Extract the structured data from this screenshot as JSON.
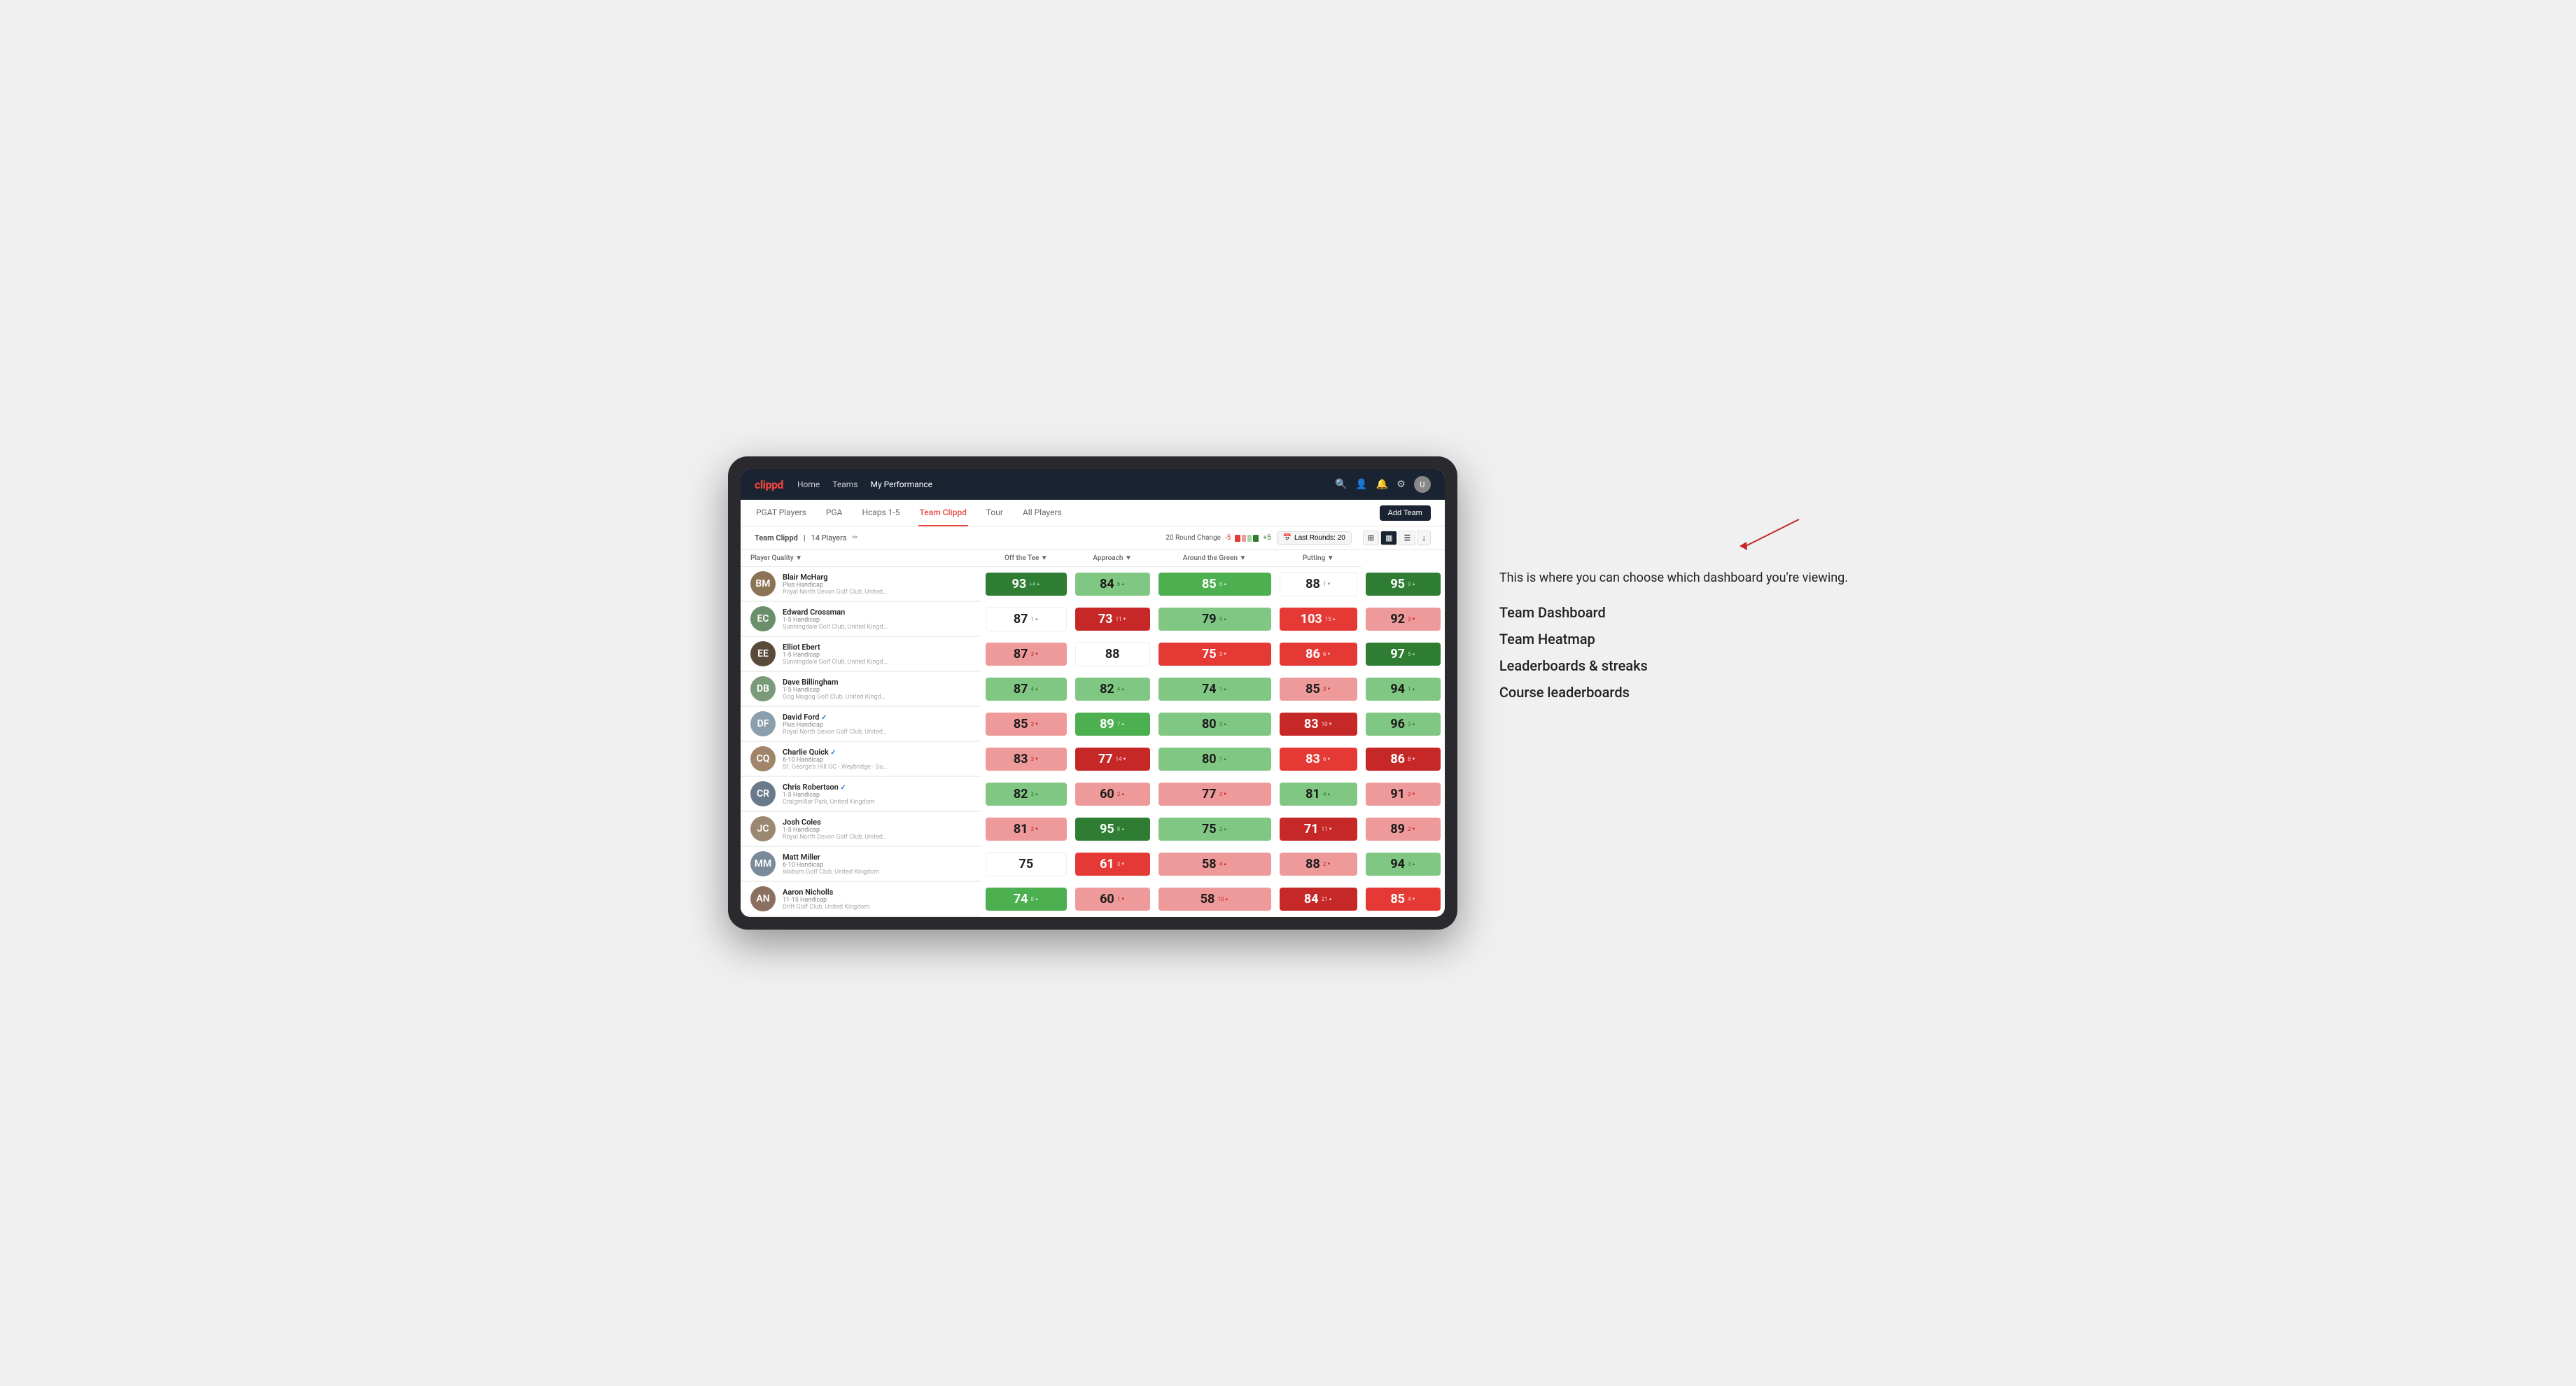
{
  "annotation": {
    "intro": "This is where you can choose which dashboard you're viewing.",
    "items": [
      "Team Dashboard",
      "Team Heatmap",
      "Leaderboards & streaks",
      "Course leaderboards"
    ]
  },
  "nav": {
    "logo": "clippd",
    "links": [
      {
        "label": "Home",
        "active": false
      },
      {
        "label": "Teams",
        "active": false
      },
      {
        "label": "My Performance",
        "active": true
      }
    ],
    "icons": [
      "search",
      "person",
      "bell",
      "settings",
      "avatar"
    ]
  },
  "sub_nav": {
    "links": [
      {
        "label": "PGAT Players",
        "active": false
      },
      {
        "label": "PGA",
        "active": false
      },
      {
        "label": "Hcaps 1-5",
        "active": false
      },
      {
        "label": "Team Clippd",
        "active": true
      },
      {
        "label": "Tour",
        "active": false
      },
      {
        "label": "All Players",
        "active": false
      }
    ],
    "add_team_label": "Add Team"
  },
  "team_header": {
    "name": "Team Clippd",
    "count": "14 Players",
    "round_change_label": "20 Round Change",
    "minus_label": "-5",
    "plus_label": "+5",
    "last_rounds_label": "Last Rounds: 20",
    "views": [
      "grid",
      "heatmap",
      "list",
      "export"
    ]
  },
  "table": {
    "columns": [
      {
        "label": "Player Quality ▼",
        "key": "quality"
      },
      {
        "label": "Off the Tee ▼",
        "key": "off_tee"
      },
      {
        "label": "Approach ▼",
        "key": "approach"
      },
      {
        "label": "Around the Green ▼",
        "key": "around_green"
      },
      {
        "label": "Putting ▼",
        "key": "putting"
      }
    ],
    "rows": [
      {
        "name": "Blair McHarg",
        "handicap": "Plus Handicap",
        "club": "Royal North Devon Golf Club, United Kingdom",
        "avatar_color": "#8b7355",
        "initials": "BM",
        "quality": {
          "value": 93,
          "change": "+4",
          "dir": "up",
          "bg": "bg-green-strong"
        },
        "off_tee": {
          "value": 84,
          "change": "6",
          "dir": "up",
          "bg": "bg-green-light"
        },
        "approach": {
          "value": 85,
          "change": "8",
          "dir": "up",
          "bg": "bg-green-medium"
        },
        "around_green": {
          "value": 88,
          "change": "1",
          "dir": "down",
          "bg": "bg-white"
        },
        "putting": {
          "value": 95,
          "change": "9",
          "dir": "up",
          "bg": "bg-green-strong"
        }
      },
      {
        "name": "Edward Crossman",
        "handicap": "1-5 Handicap",
        "club": "Sunningdale Golf Club, United Kingdom",
        "avatar_color": "#6b8e6b",
        "initials": "EC",
        "quality": {
          "value": 87,
          "change": "1",
          "dir": "up",
          "bg": "bg-white"
        },
        "off_tee": {
          "value": 73,
          "change": "11",
          "dir": "down",
          "bg": "bg-red-strong"
        },
        "approach": {
          "value": 79,
          "change": "9",
          "dir": "up",
          "bg": "bg-green-light"
        },
        "around_green": {
          "value": 103,
          "change": "15",
          "dir": "up",
          "bg": "bg-red-medium"
        },
        "putting": {
          "value": 92,
          "change": "3",
          "dir": "down",
          "bg": "bg-red-light"
        }
      },
      {
        "name": "Elliot Ebert",
        "handicap": "1-5 Handicap",
        "club": "Sunningdale Golf Club, United Kingdom",
        "avatar_color": "#5a4a3a",
        "initials": "EE",
        "quality": {
          "value": 87,
          "change": "3",
          "dir": "down",
          "bg": "bg-red-light"
        },
        "off_tee": {
          "value": 88,
          "change": "",
          "dir": "",
          "bg": "bg-white"
        },
        "approach": {
          "value": 75,
          "change": "3",
          "dir": "down",
          "bg": "bg-red-medium"
        },
        "around_green": {
          "value": 86,
          "change": "6",
          "dir": "down",
          "bg": "bg-red-medium"
        },
        "putting": {
          "value": 97,
          "change": "5",
          "dir": "up",
          "bg": "bg-green-strong"
        }
      },
      {
        "name": "Dave Billingham",
        "handicap": "1-5 Handicap",
        "club": "Gog Magog Golf Club, United Kingdom",
        "avatar_color": "#7a9a7a",
        "initials": "DB",
        "quality": {
          "value": 87,
          "change": "4",
          "dir": "up",
          "bg": "bg-green-light"
        },
        "off_tee": {
          "value": 82,
          "change": "4",
          "dir": "up",
          "bg": "bg-green-light"
        },
        "approach": {
          "value": 74,
          "change": "1",
          "dir": "up",
          "bg": "bg-green-light"
        },
        "around_green": {
          "value": 85,
          "change": "3",
          "dir": "down",
          "bg": "bg-red-light"
        },
        "putting": {
          "value": 94,
          "change": "1",
          "dir": "up",
          "bg": "bg-green-light"
        }
      },
      {
        "name": "David Ford",
        "handicap": "Plus Handicap",
        "club": "Royal North Devon Golf Club, United Kingdom",
        "avatar_color": "#8b9eab",
        "initials": "DF",
        "verified": true,
        "quality": {
          "value": 85,
          "change": "3",
          "dir": "down",
          "bg": "bg-red-light"
        },
        "off_tee": {
          "value": 89,
          "change": "7",
          "dir": "up",
          "bg": "bg-green-medium"
        },
        "approach": {
          "value": 80,
          "change": "3",
          "dir": "up",
          "bg": "bg-green-light"
        },
        "around_green": {
          "value": 83,
          "change": "10",
          "dir": "down",
          "bg": "bg-red-strong"
        },
        "putting": {
          "value": 96,
          "change": "3",
          "dir": "up",
          "bg": "bg-green-light"
        }
      },
      {
        "name": "Charlie Quick",
        "handicap": "6-10 Handicap",
        "club": "St. George's Hill GC - Weybridge - Surrey, Uni...",
        "avatar_color": "#a0856b",
        "initials": "CQ",
        "verified": true,
        "quality": {
          "value": 83,
          "change": "3",
          "dir": "down",
          "bg": "bg-red-light"
        },
        "off_tee": {
          "value": 77,
          "change": "14",
          "dir": "down",
          "bg": "bg-red-strong"
        },
        "approach": {
          "value": 80,
          "change": "1",
          "dir": "up",
          "bg": "bg-green-light"
        },
        "around_green": {
          "value": 83,
          "change": "6",
          "dir": "down",
          "bg": "bg-red-medium"
        },
        "putting": {
          "value": 86,
          "change": "8",
          "dir": "down",
          "bg": "bg-red-strong"
        }
      },
      {
        "name": "Chris Robertson",
        "handicap": "1-5 Handicap",
        "club": "Craigmillar Park, United Kingdom",
        "avatar_color": "#6b7a8b",
        "initials": "CR",
        "verified": true,
        "quality": {
          "value": 82,
          "change": "3",
          "dir": "up",
          "bg": "bg-green-light"
        },
        "off_tee": {
          "value": 60,
          "change": "2",
          "dir": "up",
          "bg": "bg-red-light"
        },
        "approach": {
          "value": 77,
          "change": "3",
          "dir": "down",
          "bg": "bg-red-light"
        },
        "around_green": {
          "value": 81,
          "change": "4",
          "dir": "up",
          "bg": "bg-green-light"
        },
        "putting": {
          "value": 91,
          "change": "3",
          "dir": "down",
          "bg": "bg-red-light"
        }
      },
      {
        "name": "Josh Coles",
        "handicap": "1-5 Handicap",
        "club": "Royal North Devon Golf Club, United Kingdom",
        "avatar_color": "#9b8870",
        "initials": "JC",
        "quality": {
          "value": 81,
          "change": "3",
          "dir": "down",
          "bg": "bg-red-light"
        },
        "off_tee": {
          "value": 95,
          "change": "8",
          "dir": "up",
          "bg": "bg-green-strong"
        },
        "approach": {
          "value": 75,
          "change": "2",
          "dir": "up",
          "bg": "bg-green-light"
        },
        "around_green": {
          "value": 71,
          "change": "11",
          "dir": "down",
          "bg": "bg-red-strong"
        },
        "putting": {
          "value": 89,
          "change": "2",
          "dir": "down",
          "bg": "bg-red-light"
        }
      },
      {
        "name": "Matt Miller",
        "handicap": "6-10 Handicap",
        "club": "Woburn Golf Club, United Kingdom",
        "avatar_color": "#7a8a9a",
        "initials": "MM",
        "quality": {
          "value": 75,
          "change": "",
          "dir": "",
          "bg": "bg-white"
        },
        "off_tee": {
          "value": 61,
          "change": "3",
          "dir": "down",
          "bg": "bg-red-medium"
        },
        "approach": {
          "value": 58,
          "change": "4",
          "dir": "up",
          "bg": "bg-red-light"
        },
        "around_green": {
          "value": 88,
          "change": "2",
          "dir": "down",
          "bg": "bg-red-light"
        },
        "putting": {
          "value": 94,
          "change": "3",
          "dir": "up",
          "bg": "bg-green-light"
        }
      },
      {
        "name": "Aaron Nicholls",
        "handicap": "11-15 Handicap",
        "club": "Drift Golf Club, United Kingdom",
        "avatar_color": "#8a7060",
        "initials": "AN",
        "quality": {
          "value": 74,
          "change": "8",
          "dir": "up",
          "bg": "bg-green-medium"
        },
        "off_tee": {
          "value": 60,
          "change": "1",
          "dir": "down",
          "bg": "bg-red-light"
        },
        "approach": {
          "value": 58,
          "change": "10",
          "dir": "up",
          "bg": "bg-red-light"
        },
        "around_green": {
          "value": 84,
          "change": "21",
          "dir": "up",
          "bg": "bg-red-strong"
        },
        "putting": {
          "value": 85,
          "change": "4",
          "dir": "down",
          "bg": "bg-red-medium"
        }
      }
    ]
  }
}
